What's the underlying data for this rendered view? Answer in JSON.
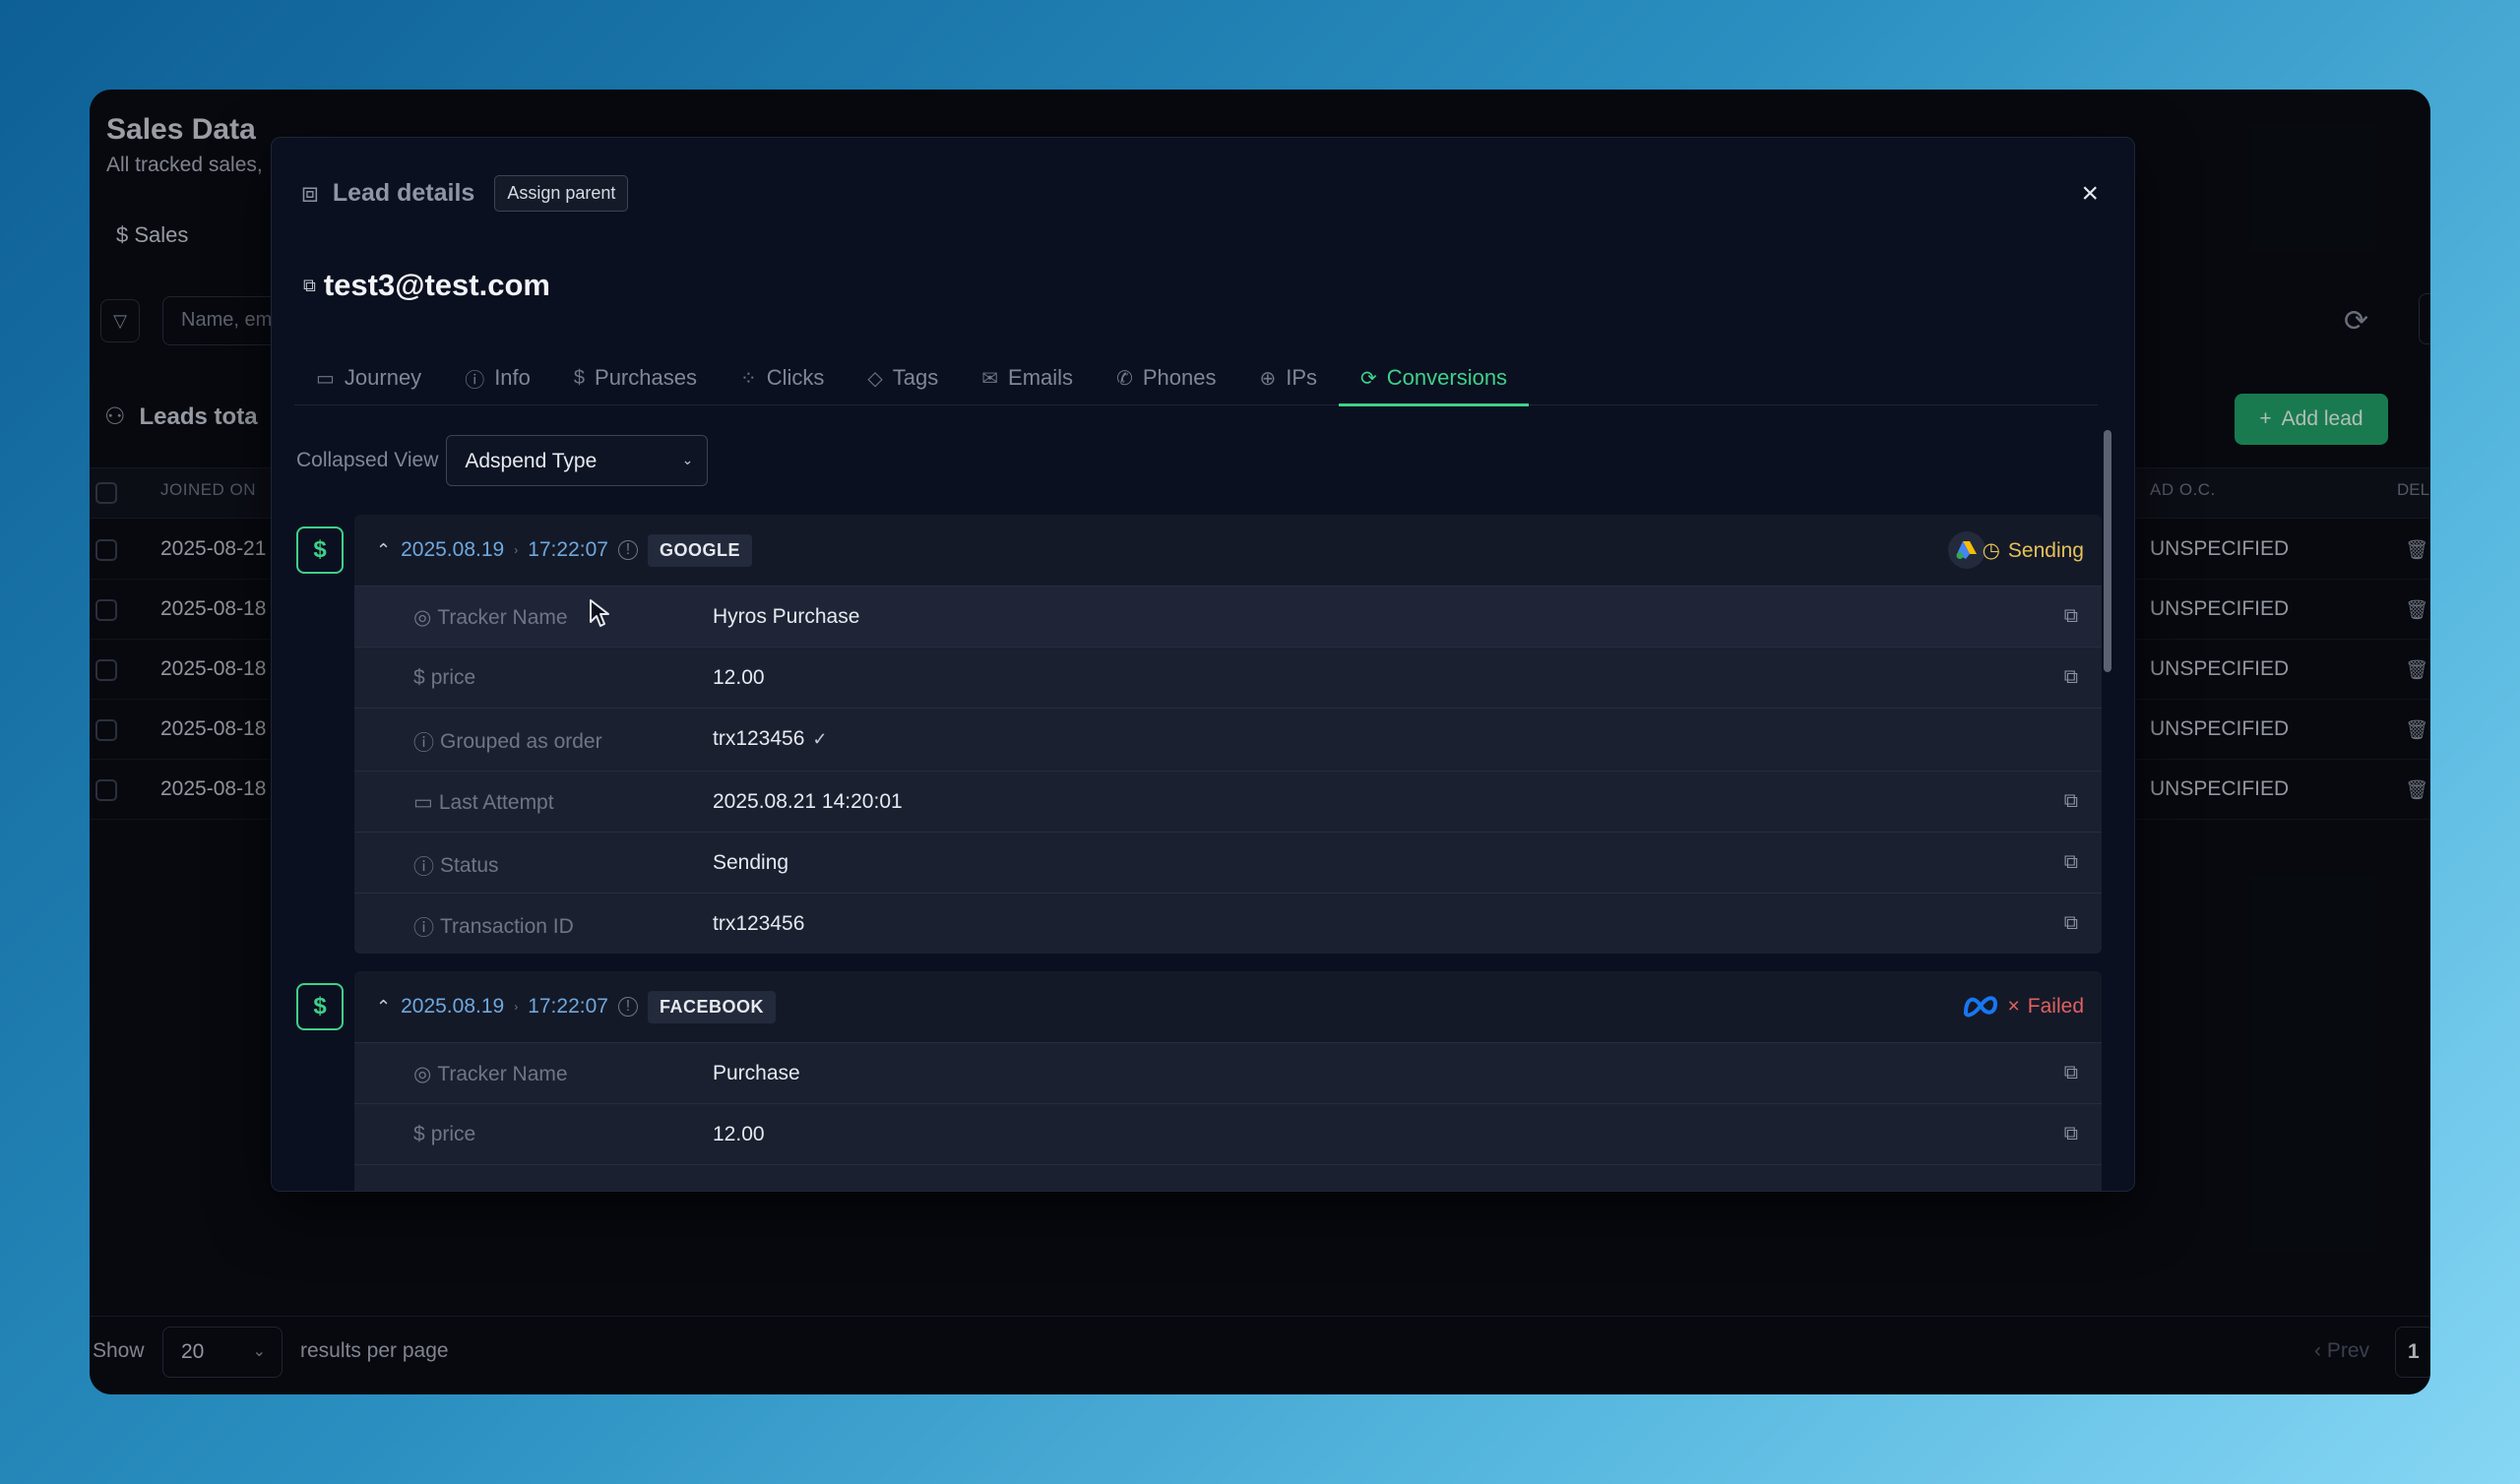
{
  "background": {
    "title": "Sales Data",
    "subtitle": "All tracked sales, l",
    "tab_sales": "Sales",
    "search_placeholder": "Name, em",
    "leads_total": "Leads tota",
    "add_lead": "Add lead",
    "col_joined": "JOINED ON",
    "col_adoc": "AD O.C.",
    "col_del": "DEL",
    "rows": [
      {
        "date": "2025-08-21",
        "ad": "UNSPECIFIED"
      },
      {
        "date": "2025-08-18",
        "ad": "UNSPECIFIED"
      },
      {
        "date": "2025-08-18",
        "ad": "UNSPECIFIED"
      },
      {
        "date": "2025-08-18",
        "ad": "UNSPECIFIED"
      },
      {
        "date": "2025-08-18",
        "ad": "UNSPECIFIED"
      }
    ],
    "footer": {
      "show": "Show",
      "per_page_value": "20",
      "results_per_page": "results per page",
      "prev": "Prev",
      "page": "1"
    }
  },
  "modal": {
    "title": "Lead details",
    "assign_parent": "Assign parent",
    "close": "×",
    "email": "test3@test.com",
    "tabs": [
      {
        "label": "Journey",
        "icon": "map-icon",
        "glyph": "▭"
      },
      {
        "label": "Info",
        "icon": "info-icon",
        "glyph": "ⓘ"
      },
      {
        "label": "Purchases",
        "icon": "dollar-icon",
        "glyph": "$"
      },
      {
        "label": "Clicks",
        "icon": "click-icon",
        "glyph": "⁘"
      },
      {
        "label": "Tags",
        "icon": "tag-icon",
        "glyph": "◇"
      },
      {
        "label": "Emails",
        "icon": "mail-icon",
        "glyph": "✉"
      },
      {
        "label": "Phones",
        "icon": "phone-icon",
        "glyph": "✆"
      },
      {
        "label": "IPs",
        "icon": "globe-icon",
        "glyph": "⊕"
      },
      {
        "label": "Conversions",
        "icon": "sync-icon",
        "glyph": "⟳",
        "active": true
      }
    ],
    "collapsed_view_label": "Collapsed View",
    "collapsed_view_value": "Adspend Type",
    "conversions": [
      {
        "date": "2025.08.19",
        "time": "17:22:07",
        "platform": "GOOGLE",
        "status": "Sending",
        "fields": [
          {
            "label": "Tracker Name",
            "value": "Hyros Purchase"
          },
          {
            "label": "price",
            "value": "12.00"
          },
          {
            "label": "Grouped as order",
            "value": "trx123456"
          },
          {
            "label": "Last Attempt",
            "value": "2025.08.21 14:20:01"
          },
          {
            "label": "Status",
            "value": "Sending"
          },
          {
            "label": "Transaction ID",
            "value": "trx123456"
          }
        ]
      },
      {
        "date": "2025.08.19",
        "time": "17:22:07",
        "platform": "FACEBOOK",
        "status": "Failed",
        "fields": [
          {
            "label": "Tracker Name",
            "value": "Purchase"
          },
          {
            "label": "price",
            "value": "12.00"
          }
        ]
      }
    ]
  },
  "colors": {
    "accent_green": "#3fd08a",
    "status_sending": "#e5c158",
    "status_failed": "#e06060",
    "date_blue": "#6fa8dc"
  }
}
